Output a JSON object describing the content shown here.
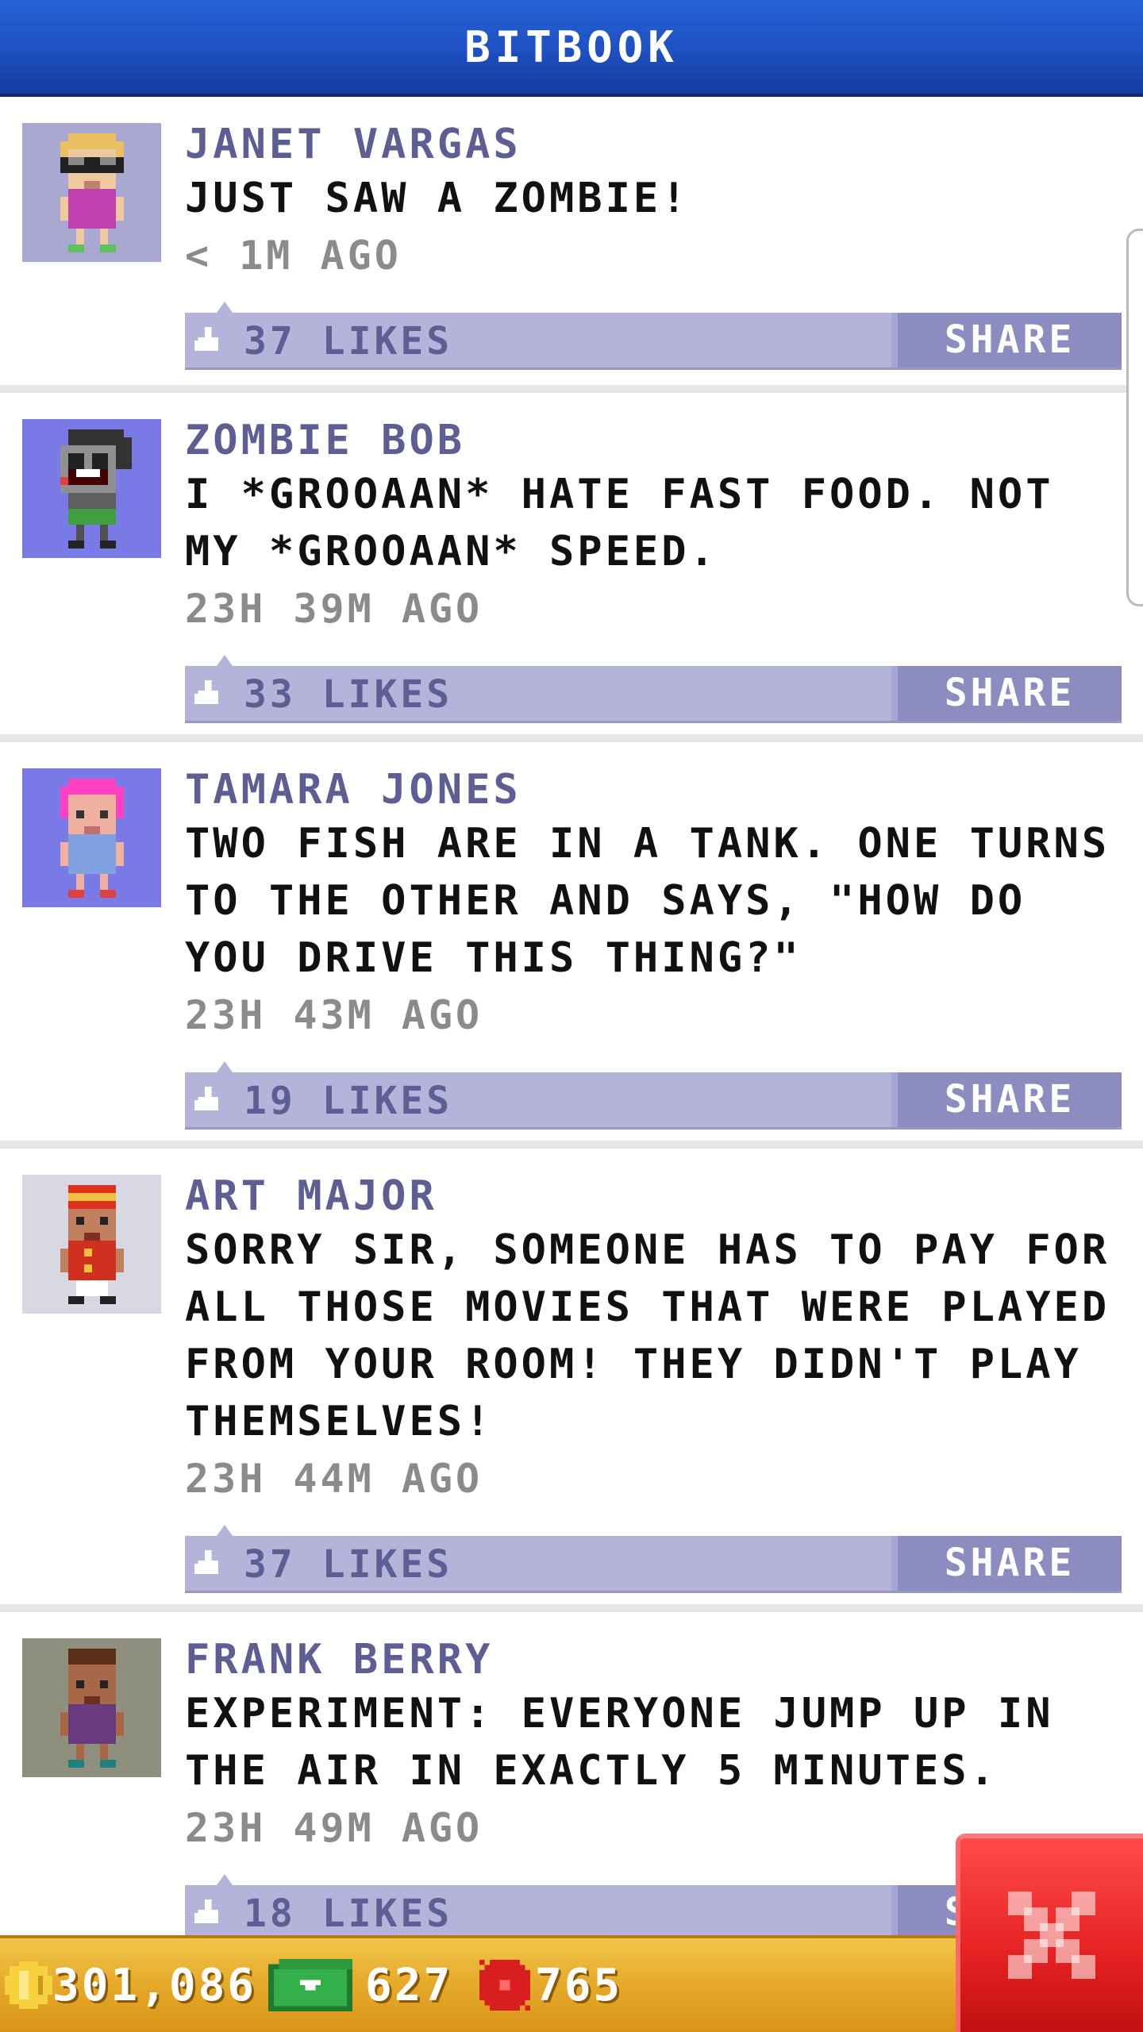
{
  "header": {
    "title": "BITBOOK"
  },
  "posts": [
    {
      "author": "JANET VARGAS",
      "message": "JUST SAW A ZOMBIE!",
      "timestamp": "< 1M AGO",
      "likes": "37 LIKES",
      "share_label": "SHARE",
      "avatar_bg": "#a8a8d0"
    },
    {
      "author": "ZOMBIE BOB",
      "message": "I *GROOAAN* HATE FAST FOOD. NOT MY *GROOAAN* SPEED.",
      "timestamp": "23H 39M AGO",
      "likes": "33 LIKES",
      "share_label": "SHARE",
      "avatar_bg": "#7a7ae6"
    },
    {
      "author": "TAMARA JONES",
      "message": "TWO FISH ARE IN A TANK. ONE TURNS TO THE OTHER AND SAYS, \"HOW DO YOU DRIVE THIS THING?\"",
      "timestamp": "23H 43M AGO",
      "likes": "19 LIKES",
      "share_label": "SHARE",
      "avatar_bg": "#7a7ae6"
    },
    {
      "author": "ART MAJOR",
      "message": "SORRY SIR, SOMEONE HAS TO PAY FOR ALL THOSE MOVIES THAT WERE PLAYED FROM YOUR ROOM! THEY DIDN'T PLAY THEMSELVES!",
      "timestamp": "23H 44M AGO",
      "likes": "37 LIKES",
      "share_label": "SHARE",
      "avatar_bg": "#d8d8e2"
    },
    {
      "author": "FRANK BERRY",
      "message": "EXPERIMENT: EVERYONE JUMP UP IN THE AIR IN EXACTLY 5 MINUTES.",
      "timestamp": "23H 49M AGO",
      "likes": "18 LIKES",
      "share_label": "SHARE",
      "avatar_bg": "#8f8f7e"
    }
  ],
  "bottom_bar": {
    "coins": "301,086",
    "bux": "627",
    "tickets": "765"
  },
  "colors": {
    "header": "#1e50c2",
    "likes_bar": "#b4b4db",
    "share_button": "#8c8cc0",
    "bottom_bar": "#e6a92a",
    "close_button": "#e52222"
  }
}
